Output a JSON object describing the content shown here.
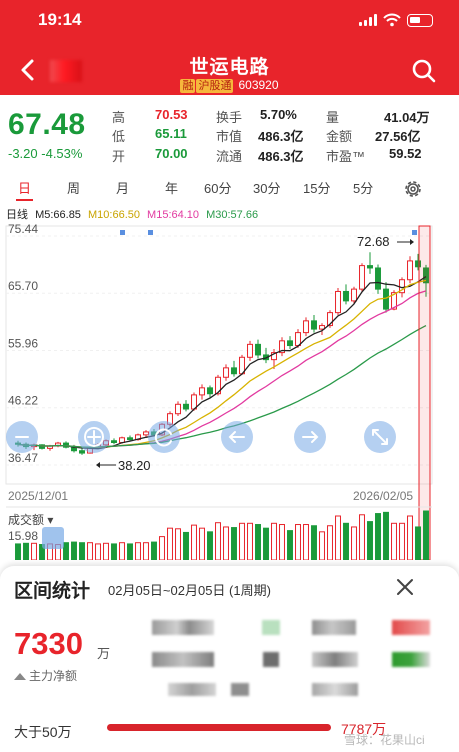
{
  "status": {
    "time": "19:14"
  },
  "header": {
    "title": "世运电路",
    "badge_margin": "融",
    "badge_connect": "沪股通",
    "code": "603920"
  },
  "quote": {
    "price": "67.48",
    "change": "-3.20",
    "change_pct": "-4.53%",
    "high_label": "高",
    "high": "70.53",
    "low_label": "低",
    "low": "65.11",
    "open_label": "开",
    "open": "70.00",
    "turnover_label": "换手",
    "turnover": "5.70%",
    "mcap_label": "市值",
    "mcap": "486.3亿",
    "float_label": "流通",
    "float": "486.3亿",
    "volume_label": "量",
    "volume": "41.04万",
    "amount_label": "金额",
    "amount": "27.56亿",
    "pe_label": "市盈™",
    "pe": "59.52"
  },
  "tabs": [
    "日",
    "周",
    "月",
    "年",
    "60分",
    "30分",
    "15分",
    "5分"
  ],
  "ma_legend": {
    "label": "日线",
    "ma5": "M5:66.85",
    "ma10": "M10:66.50",
    "ma15": "M15:64.10",
    "ma30": "M30:57.66"
  },
  "colors": {
    "up": "#e8242b",
    "down": "#1a9a3a",
    "ma5": "#222222",
    "ma10": "#d8b300",
    "ma15": "#e23aa0",
    "ma30": "#2a9a4a"
  },
  "chart_data": {
    "type": "candlestick",
    "y_ticks": [
      "75.44",
      "65.70",
      "55.96",
      "46.22",
      "36.47"
    ],
    "ylim": [
      36.47,
      75.44
    ],
    "x_labels": [
      "2025/12/01",
      "2026/02/05"
    ],
    "annotation_high": "72.68",
    "annotation_low": "38.20",
    "volume_label": "成交额",
    "volume_axis": "15.98",
    "candles": [
      [
        40.2,
        40.6,
        39.6,
        40.0
      ],
      [
        40.0,
        40.3,
        39.2,
        39.6
      ],
      [
        39.6,
        40.1,
        39.0,
        39.9
      ],
      [
        39.9,
        40.0,
        39.1,
        39.3
      ],
      [
        39.3,
        39.9,
        38.9,
        39.7
      ],
      [
        39.7,
        40.4,
        39.5,
        40.2
      ],
      [
        40.2,
        40.5,
        39.3,
        39.5
      ],
      [
        39.5,
        39.9,
        38.6,
        38.9
      ],
      [
        38.9,
        39.4,
        38.2,
        38.5
      ],
      [
        38.5,
        39.6,
        38.4,
        39.4
      ],
      [
        39.4,
        40.2,
        39.2,
        39.9
      ],
      [
        39.9,
        40.8,
        39.7,
        40.6
      ],
      [
        40.6,
        41.0,
        40.0,
        40.3
      ],
      [
        40.3,
        41.3,
        40.1,
        41.1
      ],
      [
        41.1,
        41.5,
        40.5,
        40.8
      ],
      [
        40.8,
        41.8,
        40.6,
        41.6
      ],
      [
        41.6,
        42.4,
        41.2,
        42.1
      ],
      [
        42.1,
        42.6,
        41.3,
        41.6
      ],
      [
        41.6,
        43.6,
        41.4,
        43.4
      ],
      [
        43.4,
        45.6,
        43.0,
        45.2
      ],
      [
        45.2,
        47.3,
        44.8,
        46.8
      ],
      [
        46.8,
        47.5,
        45.6,
        46.0
      ],
      [
        46.0,
        48.8,
        45.7,
        48.4
      ],
      [
        48.4,
        50.2,
        47.6,
        49.6
      ],
      [
        49.6,
        50.0,
        48.0,
        48.6
      ],
      [
        48.6,
        51.8,
        48.3,
        51.4
      ],
      [
        51.4,
        53.6,
        50.8,
        53.0
      ],
      [
        53.0,
        54.2,
        51.5,
        52.0
      ],
      [
        52.0,
        55.2,
        51.8,
        54.8
      ],
      [
        54.8,
        57.6,
        54.2,
        57.0
      ],
      [
        57.0,
        57.8,
        54.6,
        55.2
      ],
      [
        55.2,
        56.4,
        53.8,
        54.4
      ],
      [
        54.4,
        56.2,
        52.8,
        55.6
      ],
      [
        55.6,
        58.2,
        55.0,
        57.6
      ],
      [
        57.6,
        58.4,
        56.2,
        56.8
      ],
      [
        56.8,
        59.6,
        56.4,
        59.0
      ],
      [
        59.0,
        61.6,
        58.4,
        61.0
      ],
      [
        61.0,
        62.0,
        59.0,
        59.6
      ],
      [
        59.6,
        60.6,
        58.6,
        60.2
      ],
      [
        60.2,
        62.8,
        59.8,
        62.4
      ],
      [
        62.4,
        66.6,
        62.0,
        66.0
      ],
      [
        66.0,
        67.2,
        63.8,
        64.4
      ],
      [
        64.4,
        66.8,
        64.0,
        66.4
      ],
      [
        66.4,
        70.8,
        66.0,
        70.4
      ],
      [
        70.4,
        72.68,
        69.0,
        70.0
      ],
      [
        70.0,
        70.6,
        65.6,
        66.4
      ],
      [
        66.4,
        67.6,
        62.4,
        63.0
      ],
      [
        63.0,
        66.2,
        62.8,
        65.8
      ],
      [
        65.8,
        68.4,
        65.0,
        68.0
      ],
      [
        68.0,
        72.0,
        67.4,
        71.2
      ],
      [
        71.2,
        72.4,
        69.6,
        70.2
      ],
      [
        70.0,
        70.53,
        65.11,
        67.48
      ]
    ]
  },
  "stats": {
    "title": "区间统计",
    "range": "02月05日~02月05日 (1周期)",
    "net_value": "7330",
    "net_unit": "万",
    "net_label": "主力净额",
    "gt50_label": "大于50万",
    "gt50_value": "7787万",
    "watermark": "雪球：花果山ci"
  }
}
